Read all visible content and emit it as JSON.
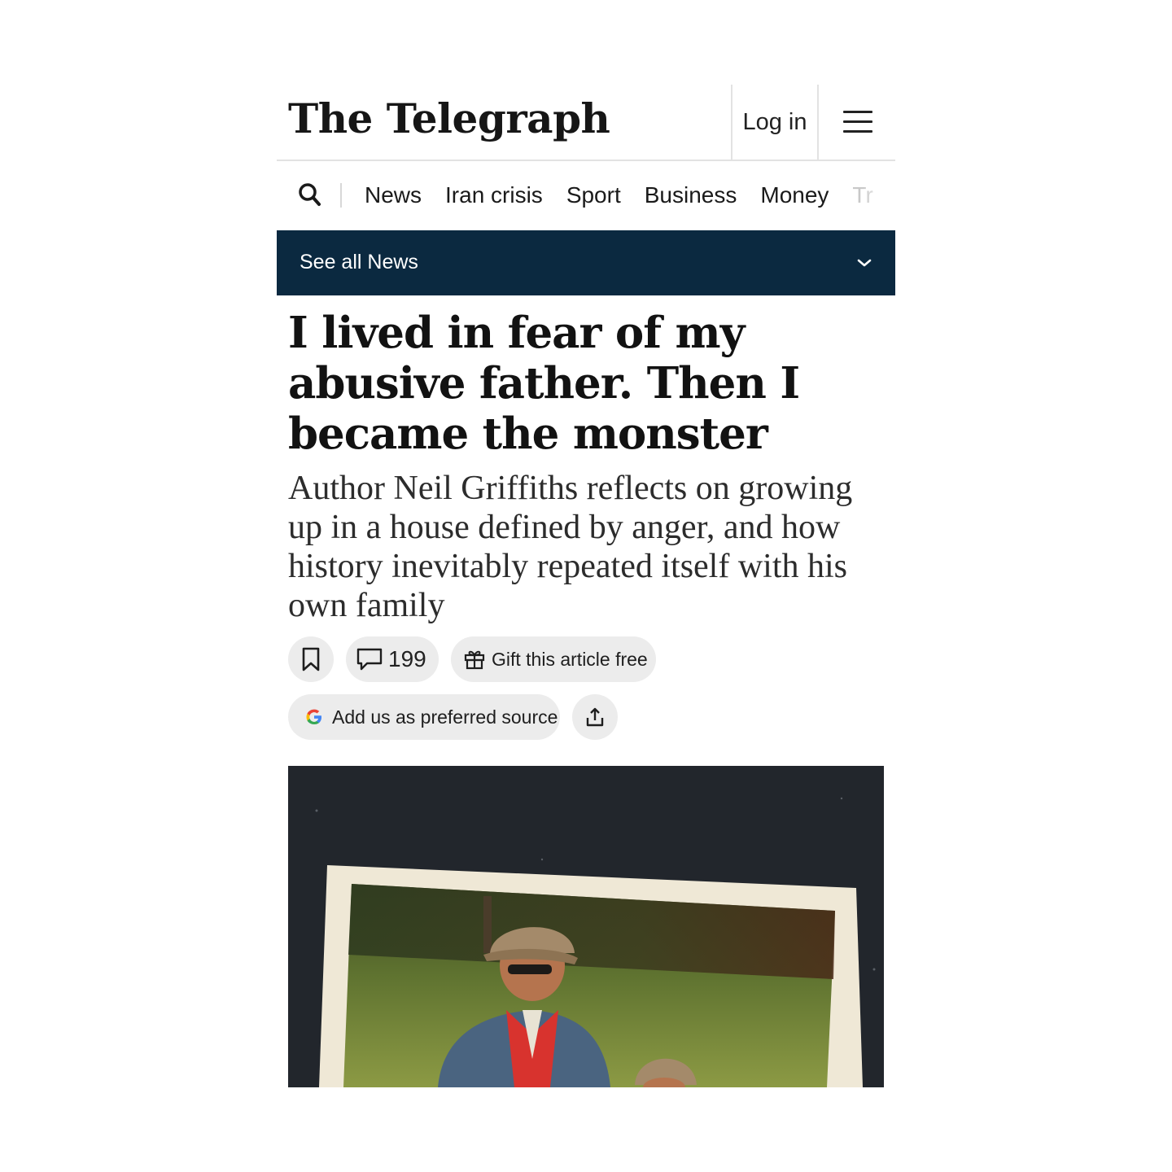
{
  "header": {
    "logo": "The Telegraph",
    "login_label": "Log in"
  },
  "nav": {
    "items": [
      "News",
      "Iran crisis",
      "Sport",
      "Business",
      "Money",
      "Tr"
    ]
  },
  "section_bar": {
    "label": "See all News"
  },
  "article": {
    "headline": "I lived in fear of my abusive father. Then I became the monster",
    "standfirst": "Author Neil Griffiths reflects on growing up in a house defined by anger, and how history inevitably repeated itself with his own family",
    "comment_count": "199",
    "gift_label": "Gift this article free",
    "preferred_source_label": "Add us as preferred source"
  },
  "colors": {
    "section_bar": "#0b2940",
    "pill_bg": "#ececec",
    "divider": "#e2e2e2"
  },
  "icons": [
    "search-icon",
    "menu-icon",
    "chevron-down-icon",
    "bookmark-icon",
    "comment-icon",
    "gift-icon",
    "google-icon",
    "share-icon"
  ]
}
